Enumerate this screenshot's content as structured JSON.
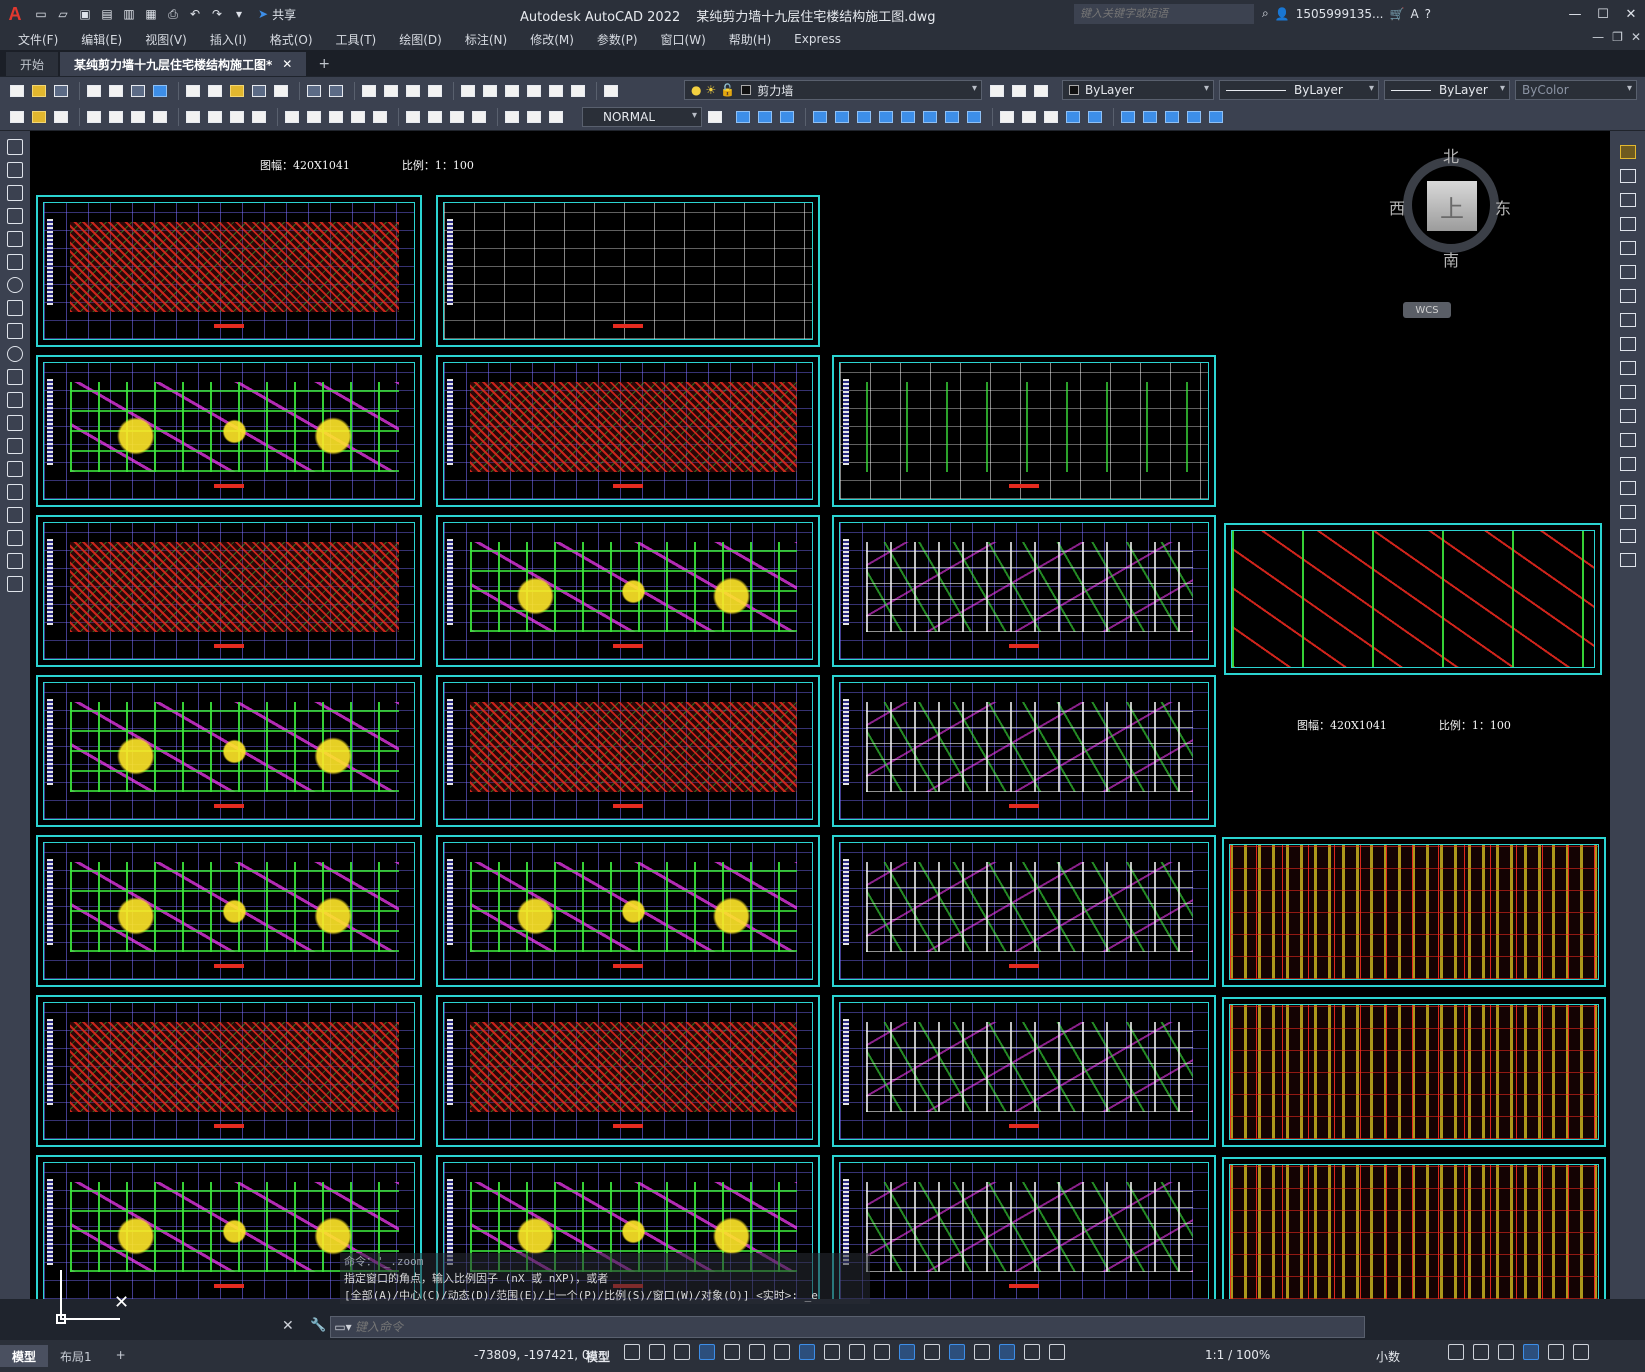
{
  "app": {
    "logo": "A",
    "title": "Autodesk AutoCAD 2022",
    "document": "某纯剪力墙十九层住宅楼结构施工图.dwg",
    "share_label": "共享",
    "search_placeholder": "键入关键字或短语",
    "user": "1505999135...",
    "help": "?"
  },
  "quick_access": [
    "new-icon",
    "open-icon",
    "save-icon",
    "saveas-icon",
    "import-icon",
    "export-icon",
    "print-icon",
    "undo-icon",
    "redo-icon"
  ],
  "menu": [
    "文件(F)",
    "编辑(E)",
    "视图(V)",
    "插入(I)",
    "格式(O)",
    "工具(T)",
    "绘图(D)",
    "标注(N)",
    "修改(M)",
    "参数(P)",
    "窗口(W)",
    "帮助(H)",
    "Express"
  ],
  "tabs": [
    {
      "label": "开始",
      "active": false
    },
    {
      "label": "某纯剪力墙十九层住宅楼结构施工图*",
      "active": true
    }
  ],
  "layer": {
    "name": "剪力墙",
    "color": "ByLayer",
    "linetype": "ByLayer",
    "lineweight": "ByLayer",
    "plotstyle": "ByColor"
  },
  "dim_style": "NORMAL",
  "drawing": {
    "sheet_size_label": "图幅：420X1041",
    "scale_label": "比例：1：100"
  },
  "viewcube": {
    "north": "北",
    "south": "南",
    "east": "东",
    "west": "西",
    "face": "上",
    "wcs": "WCS"
  },
  "command": {
    "history_1": "命令：'_.zoom",
    "history_2": "指定窗口的角点，输入比例因子 (nX 或 nXP)，或者",
    "history_3": "[全部(A)/中心(C)/动态(D)/范围(E)/上一个(P)/比例(S)/窗口(W)/对象(O)] <实时>: _e",
    "placeholder": "键入命令"
  },
  "status": {
    "layouts": [
      {
        "label": "模型",
        "active": true
      },
      {
        "label": "布局1",
        "active": false
      }
    ],
    "add_layout": "+",
    "coords": "-73809, -197421, 0",
    "space": "模型",
    "annotation_scale": "1:1 / 100%",
    "units": "小数"
  }
}
